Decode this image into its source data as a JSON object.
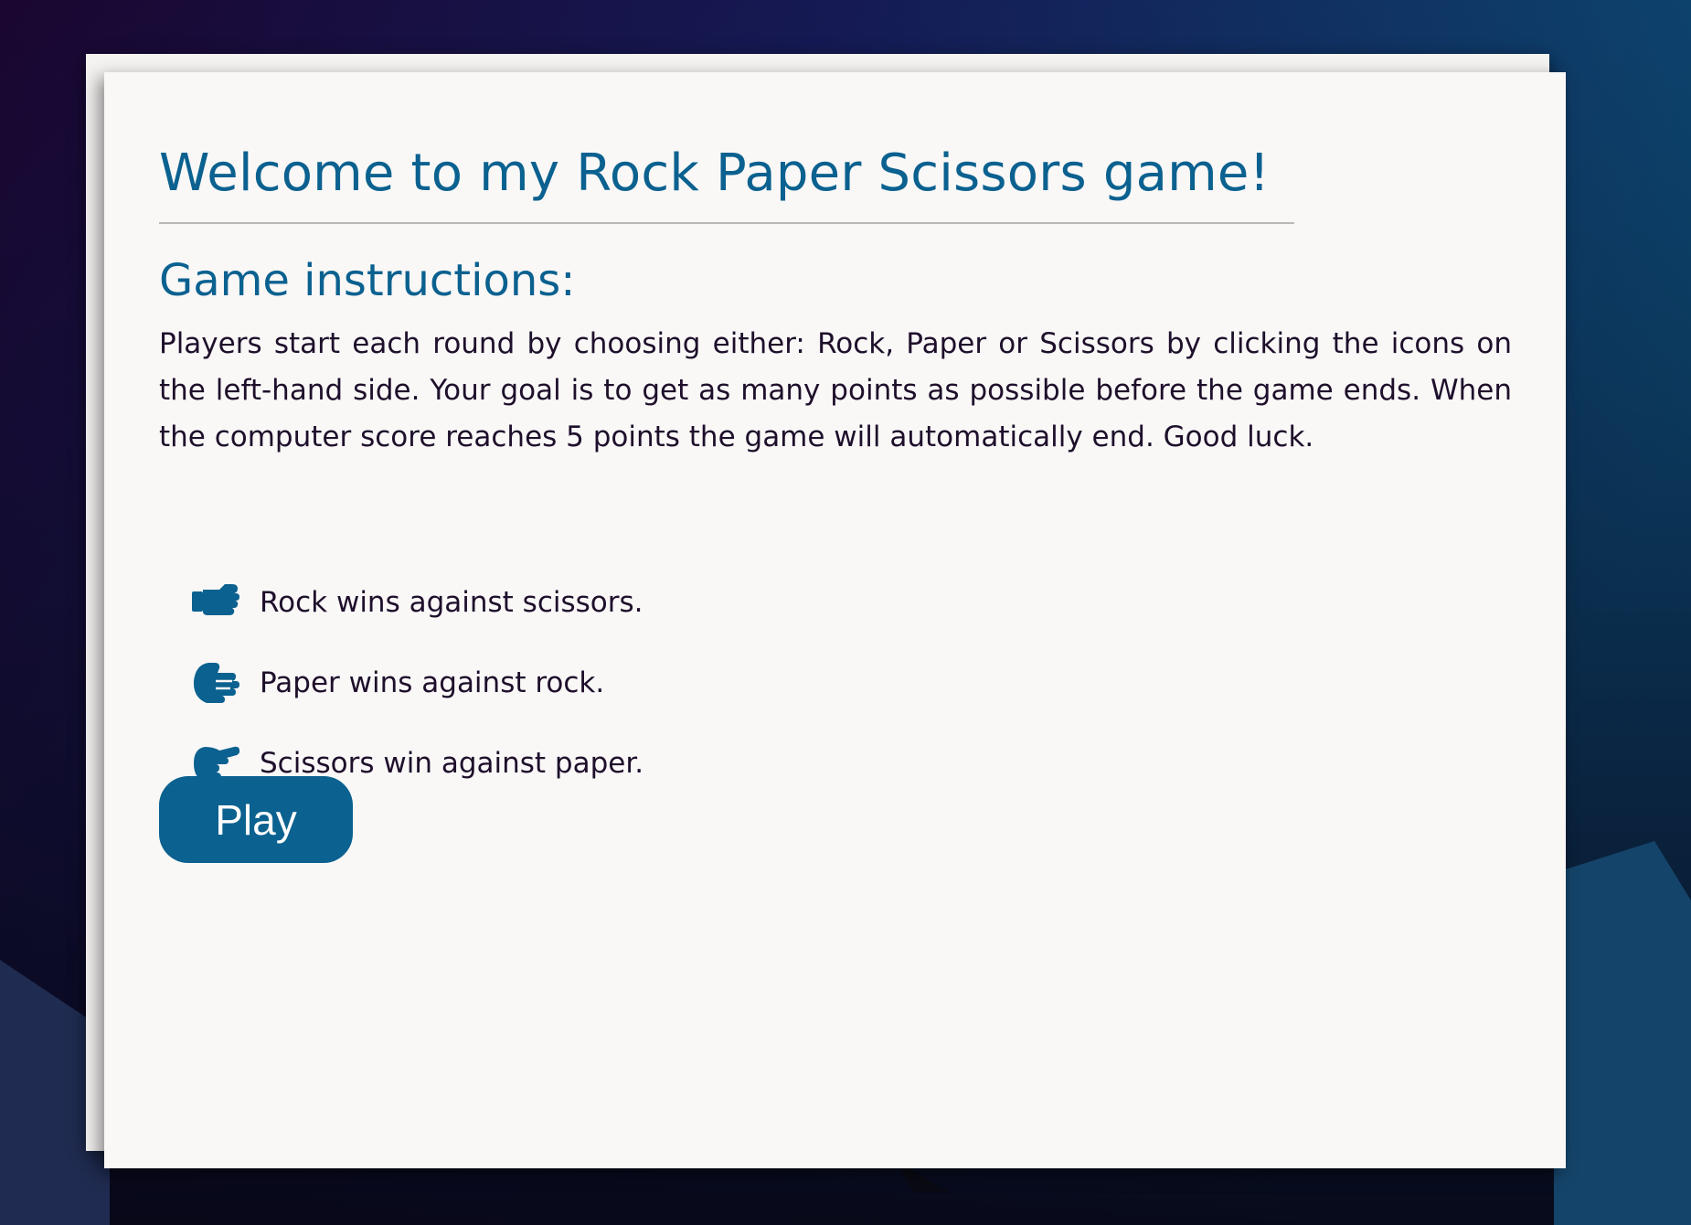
{
  "page": {
    "title": "Welcome to my Rock Paper Scissors game!",
    "subtitle": "Game instructions:",
    "instructions": "Players start each round by choosing either: Rock, Paper or Scissors by clicking the icons on the left-hand side. Your goal is to get as many points as possible before the game ends. When the computer score reaches 5 points the game will automatically end. Good luck."
  },
  "rules": [
    {
      "icon": "hand-rock-icon",
      "text": "Rock wins against scissors."
    },
    {
      "icon": "hand-paper-icon",
      "text": "Paper wins against rock."
    },
    {
      "icon": "hand-scissors-icon",
      "text": "Scissors win against paper."
    }
  ],
  "play_button": {
    "label": "Play"
  },
  "colors": {
    "accent": "#0b618f",
    "text": "#1e0f2b",
    "card": "#f9f8f7",
    "background_dark": "#0b0a1e",
    "background_blue": "#0e4f78"
  }
}
